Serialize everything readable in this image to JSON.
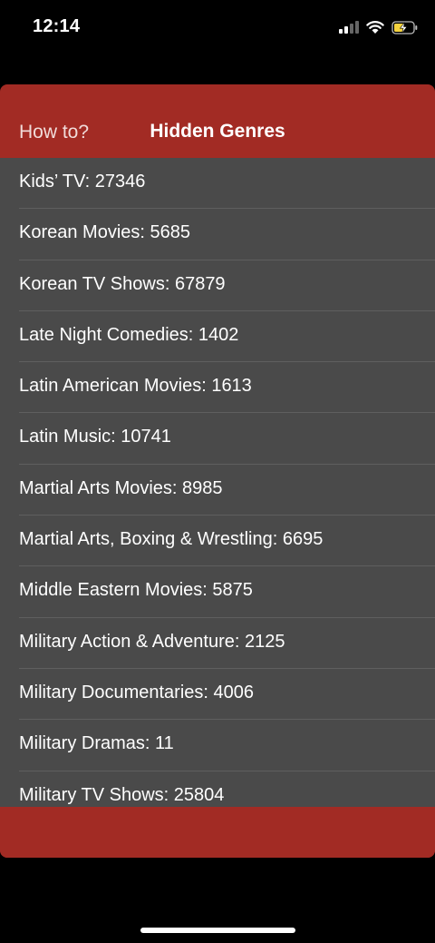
{
  "status_bar": {
    "time": "12:14"
  },
  "header": {
    "left_link": "How to?",
    "title": "Hidden Genres"
  },
  "colors": {
    "header_red": "#a22b24",
    "list_bg": "#4a4a4a",
    "battery_yellow": "#f5d33f"
  },
  "genres": [
    "Kids’ TV: 27346",
    "Korean Movies: 5685",
    "Korean TV Shows: 67879",
    "Late Night Comedies: 1402",
    "Latin American Movies: 1613",
    "Latin Music: 10741",
    "Martial Arts Movies: 8985",
    "Martial Arts, Boxing & Wrestling: 6695",
    "Middle Eastern Movies: 5875",
    "Military Action & Adventure: 2125",
    "Military Documentaries: 4006",
    "Military Dramas: 11",
    "Military TV Shows: 25804"
  ]
}
